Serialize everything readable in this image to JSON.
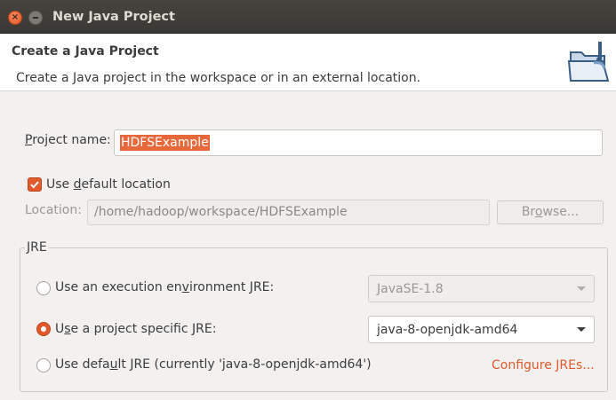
{
  "window": {
    "title": "New Java Project",
    "close_glyph": "×"
  },
  "header": {
    "title": "Create a Java Project",
    "description": "Create a Java project in the workspace or in an external location."
  },
  "project_name": {
    "label_mnemonic": "P",
    "label_rest": "roject name:",
    "value": "HDFSExample"
  },
  "use_default_location": {
    "checked": true,
    "label_pre": "Use ",
    "label_mnemonic": "d",
    "label_rest": "efault location"
  },
  "location": {
    "label": "Location:",
    "value": "/home/hadoop/workspace/HDFSExample",
    "browse_pre": "Br",
    "browse_mnemonic": "o",
    "browse_rest": "wse..."
  },
  "jre": {
    "group_title": "JRE",
    "options": [
      {
        "label_pre": "Use an execution en",
        "label_mnemonic": "v",
        "label_rest": "ironment JRE:",
        "selected": false,
        "combo_value": "JavaSE-1.8",
        "combo_enabled": false
      },
      {
        "label_pre": "U",
        "label_mnemonic": "s",
        "label_rest": "e a project specific JRE:",
        "selected": true,
        "combo_value": "java-8-openjdk-amd64",
        "combo_enabled": true
      },
      {
        "label_pre": "Use defa",
        "label_mnemonic": "u",
        "label_rest": "lt JRE (currently 'java-8-openjdk-amd64')",
        "selected": false
      }
    ],
    "configure_link": "Configure JREs..."
  },
  "colors": {
    "accent": "#e1592c",
    "titlebar": "#3c3b37"
  }
}
